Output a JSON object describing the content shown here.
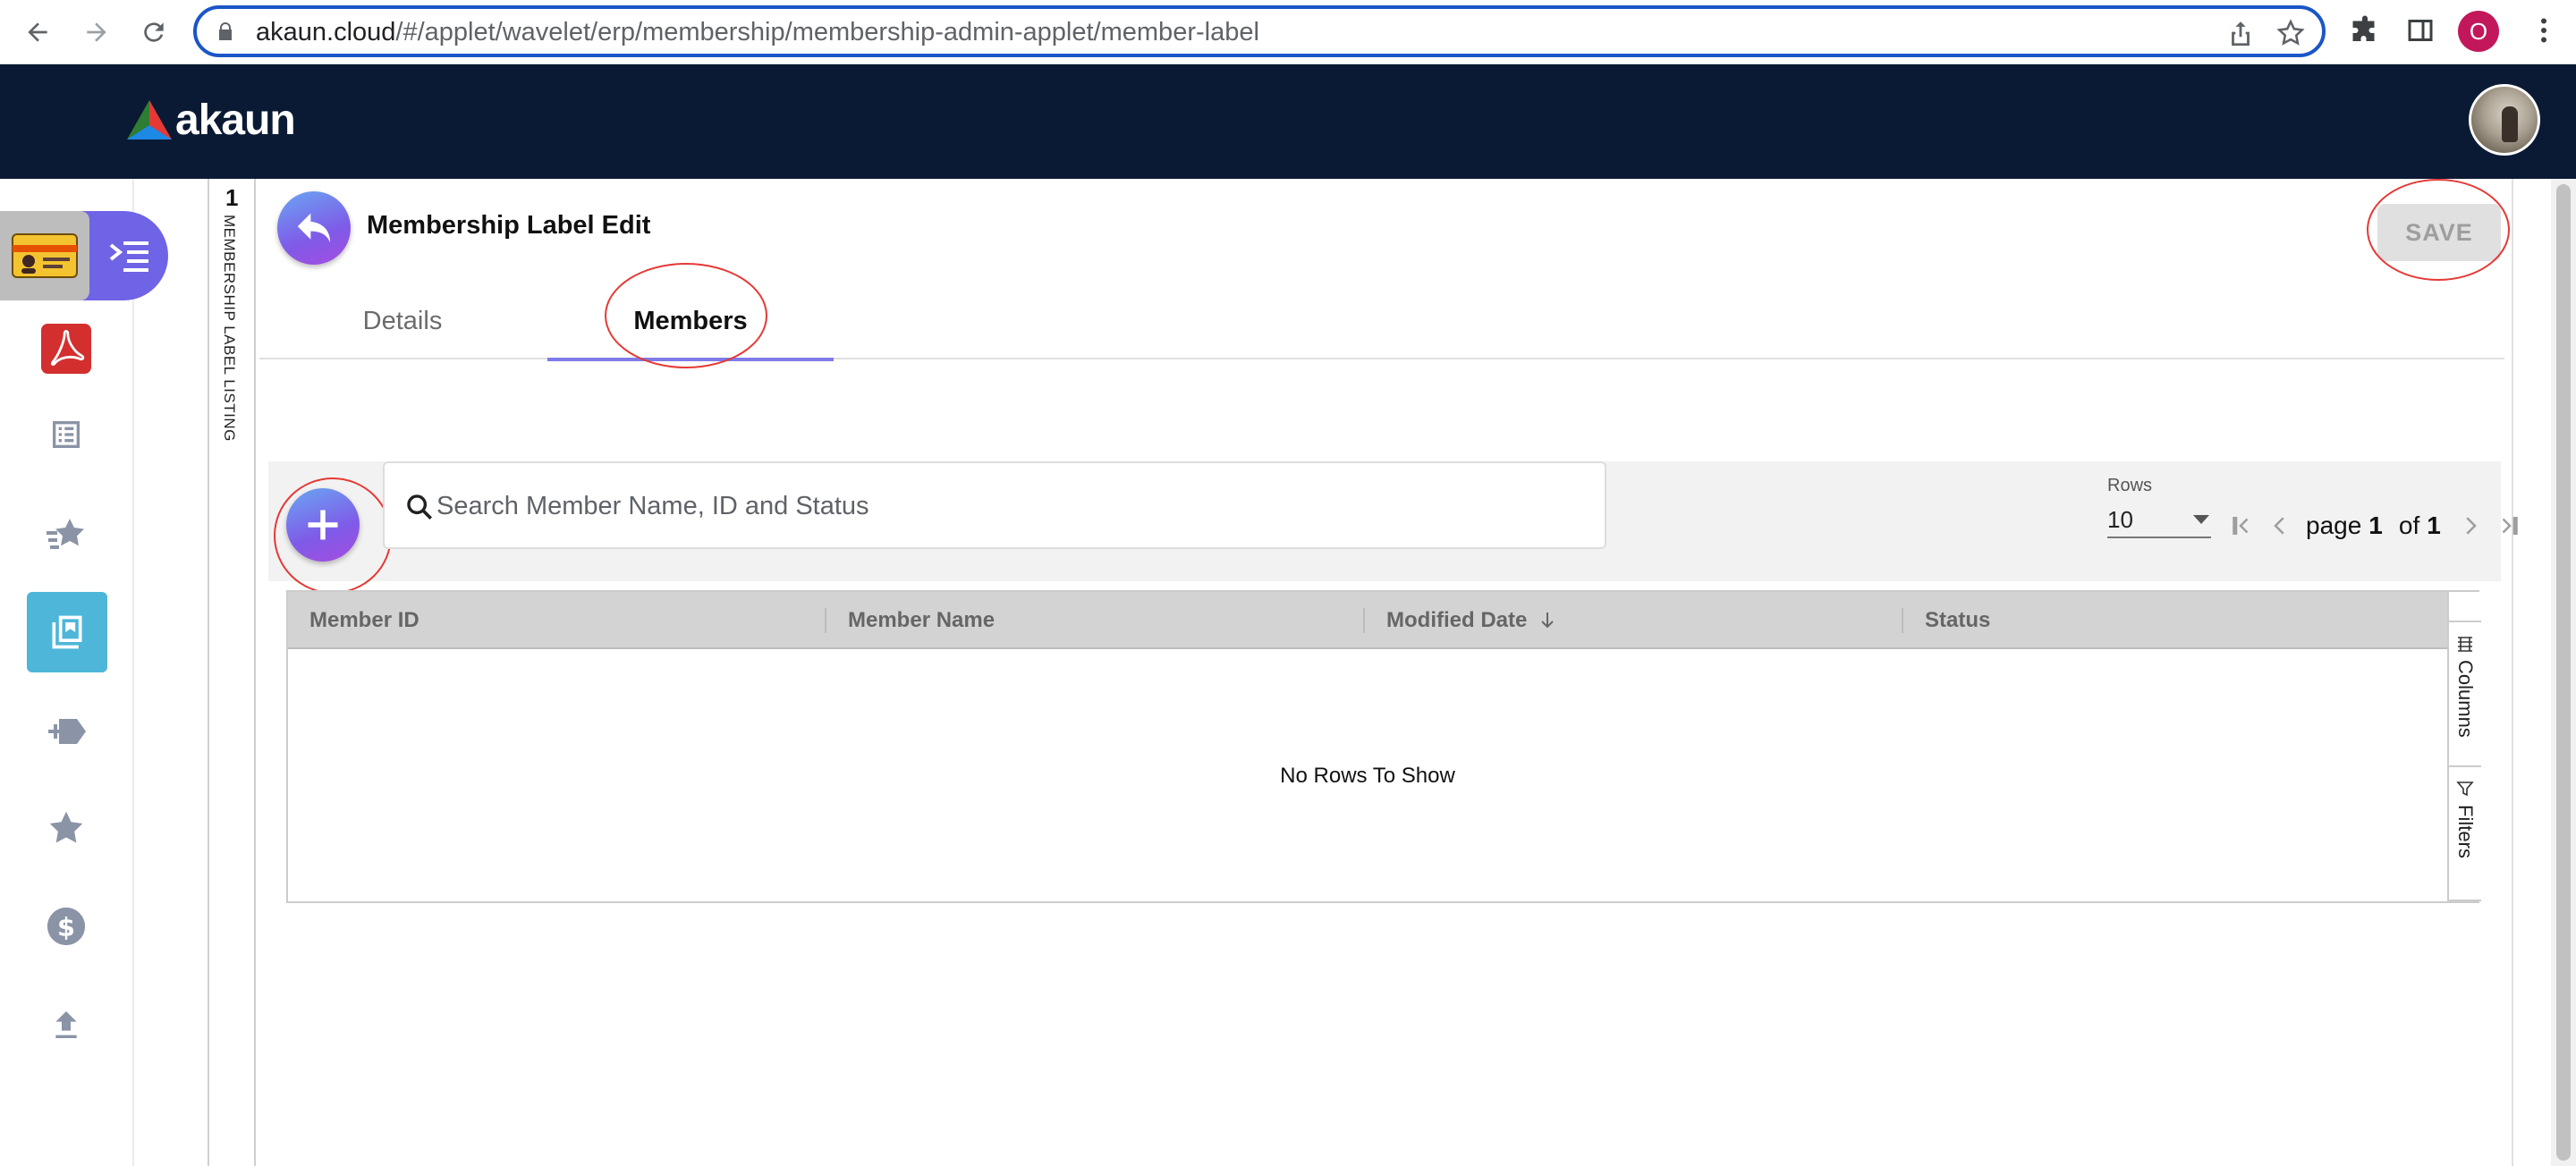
{
  "browser": {
    "url_host": "akaun.cloud",
    "url_path": "/#/applet/wavelet/erp/membership/membership-admin-applet/member-label",
    "profile_initial": "O"
  },
  "header": {
    "logo_text": "akaun"
  },
  "listing": {
    "count": "1",
    "label": "MEMBERSHIP LABEL LISTING"
  },
  "page": {
    "title": "Membership Label Edit",
    "save_label": "SAVE"
  },
  "tabs": [
    {
      "label": "Details"
    },
    {
      "label": "Members"
    }
  ],
  "search": {
    "placeholder": "Search Member Name, ID and Status"
  },
  "pagination": {
    "rows_label": "Rows",
    "rows_value": "10",
    "page_word": "page",
    "current_page": "1",
    "of_word": "of",
    "total_pages": "1"
  },
  "grid": {
    "columns": [
      "Member ID",
      "Member Name",
      "Modified Date",
      "Status"
    ],
    "empty_text": "No Rows To Show",
    "side_tools": {
      "columns": "Columns",
      "filters": "Filters"
    }
  },
  "colors": {
    "header_bg": "#0b1a34",
    "accent_purple": "#6f63e6",
    "active_item": "#4db6d9",
    "annotation_red": "#e53935"
  },
  "icons": {
    "sidebar": [
      "membership-card-icon",
      "acrobat-icon",
      "list-icon",
      "star-rating-icon",
      "book-icon",
      "tag-plus-icon",
      "star-icon",
      "dollar-icon",
      "upload-icon"
    ]
  }
}
